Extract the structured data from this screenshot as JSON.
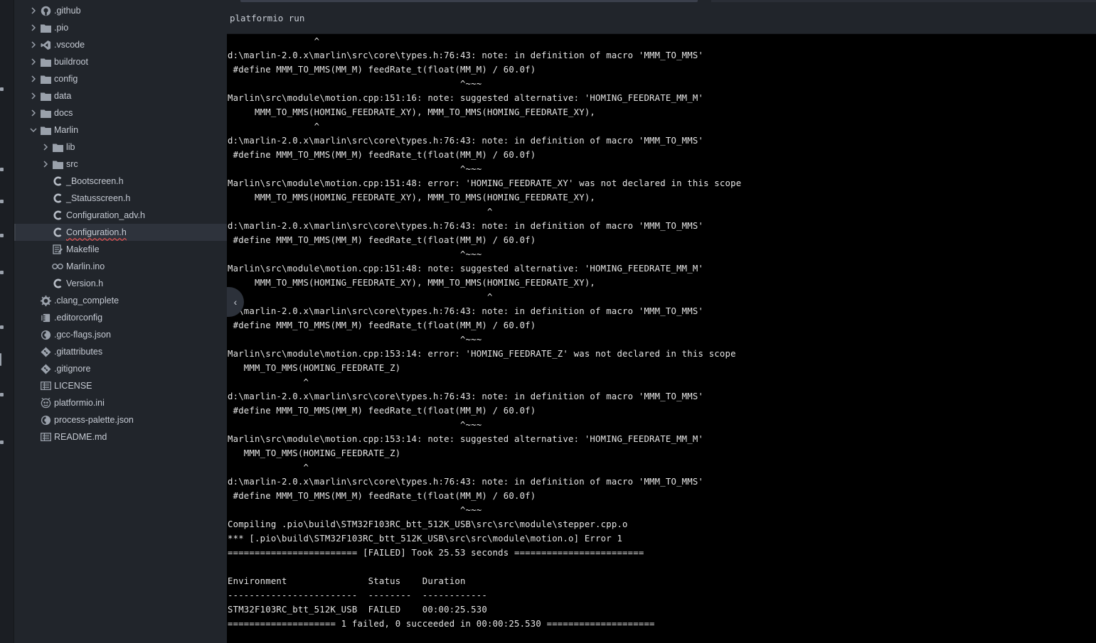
{
  "sidebar": {
    "items": [
      {
        "label": ".github",
        "depth": 0,
        "chevron": "right",
        "icon": "github-icon"
      },
      {
        "label": ".pio",
        "depth": 0,
        "chevron": "right",
        "icon": "folder-icon"
      },
      {
        "label": ".vscode",
        "depth": 0,
        "chevron": "right",
        "icon": "vscode-icon"
      },
      {
        "label": "buildroot",
        "depth": 0,
        "chevron": "right",
        "icon": "folder-icon"
      },
      {
        "label": "config",
        "depth": 0,
        "chevron": "right",
        "icon": "folder-icon"
      },
      {
        "label": "data",
        "depth": 0,
        "chevron": "right",
        "icon": "folder-icon"
      },
      {
        "label": "docs",
        "depth": 0,
        "chevron": "right",
        "icon": "folder-icon"
      },
      {
        "label": "Marlin",
        "depth": 0,
        "chevron": "down",
        "icon": "folder-icon"
      },
      {
        "label": "lib",
        "depth": 1,
        "chevron": "right",
        "icon": "folder-icon"
      },
      {
        "label": "src",
        "depth": 1,
        "chevron": "right",
        "icon": "folder-icon"
      },
      {
        "label": "_Bootscreen.h",
        "depth": 1,
        "chevron": "",
        "icon": "c-file-icon"
      },
      {
        "label": "_Statusscreen.h",
        "depth": 1,
        "chevron": "",
        "icon": "c-file-icon"
      },
      {
        "label": "Configuration_adv.h",
        "depth": 1,
        "chevron": "",
        "icon": "c-file-icon"
      },
      {
        "label": "Configuration.h",
        "depth": 1,
        "chevron": "",
        "icon": "c-file-icon",
        "selected": true
      },
      {
        "label": "Makefile",
        "depth": 1,
        "chevron": "",
        "icon": "makefile-icon"
      },
      {
        "label": "Marlin.ino",
        "depth": 1,
        "chevron": "",
        "icon": "arduino-icon"
      },
      {
        "label": "Version.h",
        "depth": 1,
        "chevron": "",
        "icon": "c-file-icon"
      },
      {
        "label": ".clang_complete",
        "depth": 0,
        "chevron": "",
        "icon": "gear-icon"
      },
      {
        "label": ".editorconfig",
        "depth": 0,
        "chevron": "",
        "icon": "editorconfig-icon"
      },
      {
        "label": ".gcc-flags.json",
        "depth": 0,
        "chevron": "",
        "icon": "json-icon"
      },
      {
        "label": ".gitattributes",
        "depth": 0,
        "chevron": "",
        "icon": "git-icon"
      },
      {
        "label": ".gitignore",
        "depth": 0,
        "chevron": "",
        "icon": "git-icon"
      },
      {
        "label": "LICENSE",
        "depth": 0,
        "chevron": "",
        "icon": "license-icon"
      },
      {
        "label": "platformio.ini",
        "depth": 0,
        "chevron": "",
        "icon": "platformio-icon"
      },
      {
        "label": "process-palette.json",
        "depth": 0,
        "chevron": "",
        "icon": "json-icon"
      },
      {
        "label": "README.md",
        "depth": 0,
        "chevron": "",
        "icon": "readme-icon"
      }
    ]
  },
  "panel": {
    "title": "platformio run"
  },
  "terminal": {
    "lines": [
      "                ^",
      "d:\\marlin-2.0.x\\marlin\\src\\core\\types.h:76:43: note: in definition of macro 'MMM_TO_MMS'",
      " #define MMM_TO_MMS(MM_M) feedRate_t(float(MM_M) / 60.0f)",
      "                                           ^~~~",
      "Marlin\\src\\module\\motion.cpp:151:16: note: suggested alternative: 'HOMING_FEEDRATE_MM_M'",
      "     MMM_TO_MMS(HOMING_FEEDRATE_XY), MMM_TO_MMS(HOMING_FEEDRATE_XY),",
      "                ^",
      "d:\\marlin-2.0.x\\marlin\\src\\core\\types.h:76:43: note: in definition of macro 'MMM_TO_MMS'",
      " #define MMM_TO_MMS(MM_M) feedRate_t(float(MM_M) / 60.0f)",
      "                                           ^~~~",
      "Marlin\\src\\module\\motion.cpp:151:48: error: 'HOMING_FEEDRATE_XY' was not declared in this scope",
      "     MMM_TO_MMS(HOMING_FEEDRATE_XY), MMM_TO_MMS(HOMING_FEEDRATE_XY),",
      "                                                ^",
      "d:\\marlin-2.0.x\\marlin\\src\\core\\types.h:76:43: note: in definition of macro 'MMM_TO_MMS'",
      " #define MMM_TO_MMS(MM_M) feedRate_t(float(MM_M) / 60.0f)",
      "                                           ^~~~",
      "Marlin\\src\\module\\motion.cpp:151:48: note: suggested alternative: 'HOMING_FEEDRATE_MM_M'",
      "     MMM_TO_MMS(HOMING_FEEDRATE_XY), MMM_TO_MMS(HOMING_FEEDRATE_XY),",
      "                                                ^",
      "d:\\marlin-2.0.x\\marlin\\src\\core\\types.h:76:43: note: in definition of macro 'MMM_TO_MMS'",
      " #define MMM_TO_MMS(MM_M) feedRate_t(float(MM_M) / 60.0f)",
      "                                           ^~~~",
      "Marlin\\src\\module\\motion.cpp:153:14: error: 'HOMING_FEEDRATE_Z' was not declared in this scope",
      "   MMM_TO_MMS(HOMING_FEEDRATE_Z)",
      "              ^",
      "d:\\marlin-2.0.x\\marlin\\src\\core\\types.h:76:43: note: in definition of macro 'MMM_TO_MMS'",
      " #define MMM_TO_MMS(MM_M) feedRate_t(float(MM_M) / 60.0f)",
      "                                           ^~~~",
      "Marlin\\src\\module\\motion.cpp:153:14: note: suggested alternative: 'HOMING_FEEDRATE_MM_M'",
      "   MMM_TO_MMS(HOMING_FEEDRATE_Z)",
      "              ^",
      "d:\\marlin-2.0.x\\marlin\\src\\core\\types.h:76:43: note: in definition of macro 'MMM_TO_MMS'",
      " #define MMM_TO_MMS(MM_M) feedRate_t(float(MM_M) / 60.0f)",
      "                                           ^~~~",
      "Compiling .pio\\build\\STM32F103RC_btt_512K_USB\\src\\src\\module\\stepper.cpp.o",
      "*** [.pio\\build\\STM32F103RC_btt_512K_USB\\src\\src\\module\\motion.o] Error 1",
      "======================== [FAILED] Took 25.53 seconds ========================",
      "",
      "Environment               Status    Duration",
      "------------------------  --------  ------------",
      "STM32F103RC_btt_512K_USB  FAILED    00:00:25.530",
      "==================== 1 failed, 0 succeeded in 00:00:25.530 ===================="
    ]
  },
  "colors": {
    "terminal_bg": "#000000",
    "terminal_fg": "#e6e6e6",
    "sidebar_bg": "#21252b",
    "selected_bg": "#2e333c"
  }
}
